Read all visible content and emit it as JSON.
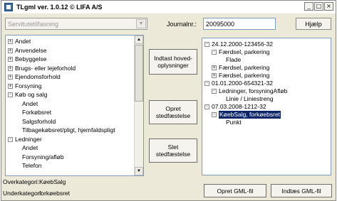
{
  "window": {
    "title": "TLgml ver. 1.0.12 © LIFA A/S",
    "buttons": {
      "minimize": "_",
      "maximize": "□",
      "close": "×"
    }
  },
  "toolbar": {
    "combo_value": "Servitutetilfasning",
    "journal_label": "Journalnr.:",
    "journal_value": "20095000",
    "help_label": "Hjælp"
  },
  "left_tree": {
    "items": [
      {
        "label": "Andet",
        "expander": "+",
        "level": 0
      },
      {
        "label": "Anvendelse",
        "expander": "+",
        "level": 0
      },
      {
        "label": "Bebyggelse",
        "expander": "+",
        "level": 0
      },
      {
        "label": "Brugs- eller lejeforhold",
        "expander": "+",
        "level": 0
      },
      {
        "label": "Ejendomsforhold",
        "expander": "+",
        "level": 0
      },
      {
        "label": "Forsyning",
        "expander": "+",
        "level": 0
      },
      {
        "label": "Køb og salg",
        "expander": "-",
        "level": 0
      },
      {
        "label": "Andet",
        "expander": "",
        "level": 1
      },
      {
        "label": "Forkøbsret",
        "expander": "",
        "level": 1
      },
      {
        "label": "Salgsforhold",
        "expander": "",
        "level": 1
      },
      {
        "label": "Tilbagekøbsret/pligt, hjemfaldspligt",
        "expander": "",
        "level": 1
      },
      {
        "label": "Ledninger",
        "expander": "-",
        "level": 0
      },
      {
        "label": "Andet",
        "expander": "",
        "level": 1
      },
      {
        "label": "Forsyning/afløb",
        "expander": "",
        "level": 1
      },
      {
        "label": "Telefon",
        "expander": "",
        "level": 1
      }
    ]
  },
  "buttons": {
    "indtast": "Indtast hoved-\noplysninger",
    "opret_sted": "Opret\nstedfæstelse",
    "slet_sted": "Slet\nstedfæstelse",
    "opret_gml": "Opret GML-fil",
    "indlaes_gml": "Indlæs GML-fil"
  },
  "right_tree": {
    "items": [
      {
        "label": "24.12.2000-123456-32",
        "expander": "-",
        "level": 0
      },
      {
        "label": "Færdsel, parkering",
        "expander": "-",
        "level": 1
      },
      {
        "label": "Flade",
        "expander": "",
        "level": 2
      },
      {
        "label": "Færdsel, parkering",
        "expander": "+",
        "level": 1
      },
      {
        "label": "Færdsel, parkering",
        "expander": "+",
        "level": 1
      },
      {
        "label": "01.01.2000-654321-32",
        "expander": "-",
        "level": 0
      },
      {
        "label": "Ledninger, forsyningAfløb",
        "expander": "-",
        "level": 1
      },
      {
        "label": "Linie / Liniestreng",
        "expander": "",
        "level": 2
      },
      {
        "label": "07.03.2008-1212-32",
        "expander": "-",
        "level": 0
      },
      {
        "label": "KøebSalg, forkøebsret",
        "expander": "-",
        "level": 1,
        "selected": true
      },
      {
        "label": "Punkt",
        "expander": "",
        "level": 2
      }
    ]
  },
  "categories": {
    "over_label": "Overkategori:",
    "over_value": "KøebSalg",
    "under_label": "Underkategori:",
    "under_value": "forkøebsret"
  },
  "colors": {
    "selection": "#0a246a",
    "window_bg": "#ece9d8"
  }
}
